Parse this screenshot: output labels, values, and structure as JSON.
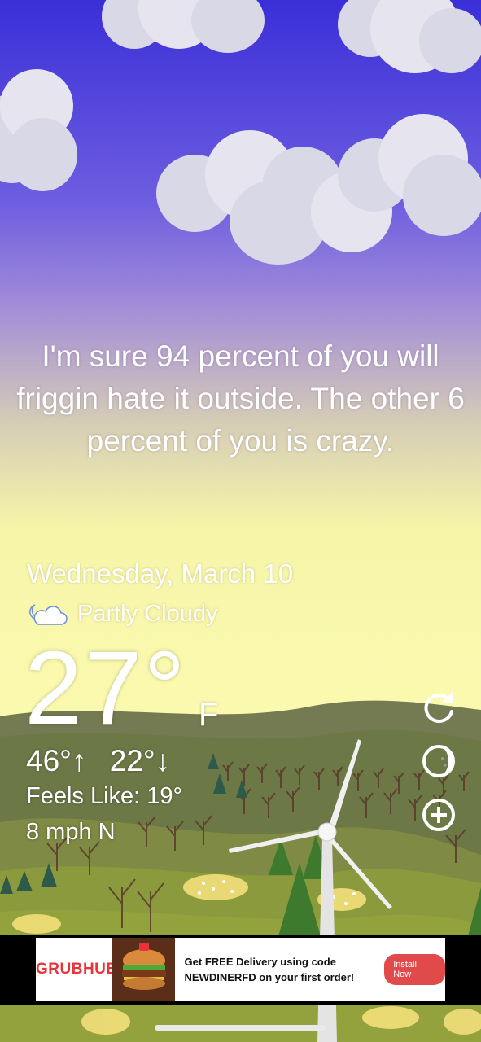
{
  "joke": "I'm sure 94 percent of you will friggin hate it outside. The other 6 percent of you is crazy.",
  "weather": {
    "date": "Wednesday, March 10",
    "condition": "Partly Cloudy",
    "condition_icon": "partly-cloudy-night-icon",
    "temperature": "27°",
    "unit": "F",
    "high": "46°↑",
    "low": "22°↓",
    "feels_like": "Feels Like: 19°",
    "wind": "8 mph N"
  },
  "side_buttons": [
    "refresh-icon",
    "moon-phase-icon",
    "add-location-icon"
  ],
  "ad": {
    "brand": "GRUBHUB",
    "text": "Get FREE Delivery using code NEWDINERFD on your first order!",
    "button": "Install Now",
    "brand_color": "#e8333b"
  }
}
